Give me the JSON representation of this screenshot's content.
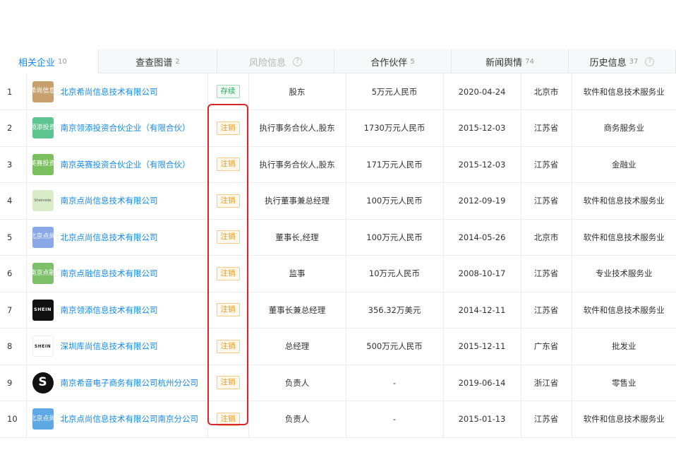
{
  "tabs": [
    {
      "label": "相关企业",
      "count": "10",
      "active": true,
      "disabled": false,
      "help": false,
      "width": 140
    },
    {
      "label": "查查图谱",
      "count": "2",
      "active": false,
      "disabled": false,
      "help": false,
      "width": 168
    },
    {
      "label": "风险信息",
      "count": "",
      "active": false,
      "disabled": true,
      "help": true,
      "width": 166
    },
    {
      "label": "合作伙伴",
      "count": "5",
      "active": false,
      "disabled": false,
      "help": false,
      "width": 166
    },
    {
      "label": "新闻舆情",
      "count": "74",
      "active": false,
      "disabled": false,
      "help": false,
      "width": 166
    },
    {
      "label": "历史信息",
      "count": "37",
      "active": false,
      "disabled": false,
      "help": true,
      "width": 152
    }
  ],
  "rows": [
    {
      "idx": "1",
      "logo": {
        "text": "希尚信息",
        "color": "#c8a06e",
        "style": "text"
      },
      "name": "北京希尚信息技术有限公司",
      "status": "存续",
      "status_type": "ok",
      "role": "股东",
      "capital": "5万元人民币",
      "date": "2020-04-24",
      "region": "北京市",
      "industry": "软件和信息技术服务业"
    },
    {
      "idx": "2",
      "logo": {
        "text": "领添投资",
        "color": "#5cc58f",
        "style": "text"
      },
      "name": "南京领添投资合伙企业（有限合伙）",
      "status": "注销",
      "status_type": "cancel",
      "role": "执行事务合伙人,股东",
      "capital": "1730万元人民币",
      "date": "2015-12-03",
      "region": "江苏省",
      "industry": "商务服务业"
    },
    {
      "idx": "3",
      "logo": {
        "text": "英赛投资",
        "color": "#7cbf5e",
        "style": "text"
      },
      "name": "南京英赛投资合伙企业（有限合伙）",
      "status": "注销",
      "status_type": "cancel",
      "role": "执行事务合伙人,股东",
      "capital": "171万元人民币",
      "date": "2015-12-03",
      "region": "江苏省",
      "industry": "金融业"
    },
    {
      "idx": "4",
      "logo": {
        "text": "Sheinside",
        "color": "#d9ecc9",
        "style": "tm"
      },
      "name": "南京点尚信息技术有限公司",
      "status": "注销",
      "status_type": "cancel",
      "role": "执行董事兼总经理",
      "capital": "100万元人民币",
      "date": "2012-09-19",
      "region": "江苏省",
      "industry": "软件和信息技术服务业"
    },
    {
      "idx": "5",
      "logo": {
        "text": "北京点尚",
        "color": "#8aa8e8",
        "style": "text"
      },
      "name": "北京点尚信息技术有限公司",
      "status": "注销",
      "status_type": "cancel",
      "role": "董事长,经理",
      "capital": "100万元人民币",
      "date": "2014-05-26",
      "region": "北京市",
      "industry": "软件和信息技术服务业"
    },
    {
      "idx": "6",
      "logo": {
        "text": "南京点融",
        "color": "#7cc06a",
        "style": "text"
      },
      "name": "南京点融信息技术有限公司",
      "status": "注销",
      "status_type": "cancel",
      "role": "监事",
      "capital": "10万元人民币",
      "date": "2008-10-17",
      "region": "江苏省",
      "industry": "专业技术服务业"
    },
    {
      "idx": "7",
      "logo": {
        "text": "SHEIN",
        "color": "#111111",
        "style": "shein-dark"
      },
      "name": "南京领添信息技术有限公司",
      "status": "注销",
      "status_type": "cancel",
      "role": "董事长兼总经理",
      "capital": "356.32万美元",
      "date": "2014-12-11",
      "region": "江苏省",
      "industry": "软件和信息技术服务业"
    },
    {
      "idx": "8",
      "logo": {
        "text": "SHEIN",
        "color": "#ffffff",
        "style": "shein-light"
      },
      "name": "深圳库尚信息技术有限公司",
      "status": "注销",
      "status_type": "cancel",
      "role": "总经理",
      "capital": "500万元人民币",
      "date": "2015-12-11",
      "region": "广东省",
      "industry": "批发业"
    },
    {
      "idx": "9",
      "logo": {
        "text": "S",
        "color": "#111111",
        "style": "s-circle"
      },
      "name": "南京希音电子商务有限公司杭州分公司",
      "status": "注销",
      "status_type": "cancel",
      "role": "负责人",
      "capital": "-",
      "date": "2019-06-14",
      "region": "浙江省",
      "industry": "零售业"
    },
    {
      "idx": "10",
      "logo": {
        "text": "北京点尚",
        "color": "#5fa8e6",
        "style": "text"
      },
      "name": "北京点尚信息技术有限公司南京分公司",
      "status": "注销",
      "status_type": "cancel",
      "role": "负责人",
      "capital": "-",
      "date": "2015-01-13",
      "region": "江苏省",
      "industry": "软件和信息技术服务业"
    }
  ]
}
